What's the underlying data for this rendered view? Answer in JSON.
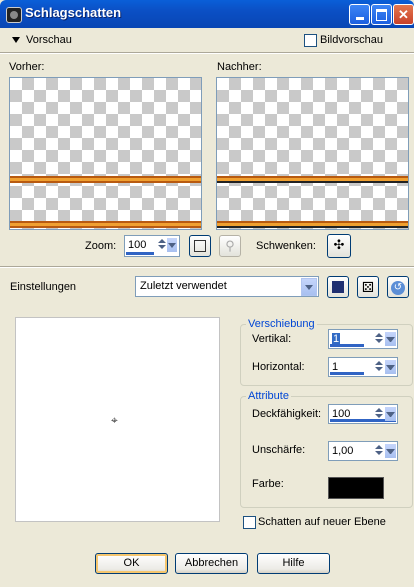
{
  "window": {
    "title": "Schlagschatten"
  },
  "preview": {
    "section_label": "Vorschau",
    "image_preview_label": "Bildvorschau",
    "before_label": "Vorher:",
    "after_label": "Nachher:",
    "zoom_label": "Zoom:",
    "zoom_value": "100",
    "pan_label": "Schwenken:"
  },
  "settings": {
    "label": "Einstellungen",
    "preset_value": "Zuletzt verwendet"
  },
  "offset": {
    "title": "Verschiebung",
    "vertical_label": "Vertikal:",
    "vertical_value": "1",
    "horizontal_label": "Horizontal:",
    "horizontal_value": "1"
  },
  "attributes": {
    "title": "Attribute",
    "opacity_label": "Deckfähigkeit:",
    "opacity_value": "100",
    "blur_label": "Unschärfe:",
    "blur_value": "1,00",
    "color_label": "Farbe:",
    "color_value": "#000000"
  },
  "shadow_on_new_layer": "Schatten auf neuer Ebene",
  "buttons": {
    "ok": "OK",
    "cancel": "Abbrechen",
    "help": "Hilfe"
  }
}
